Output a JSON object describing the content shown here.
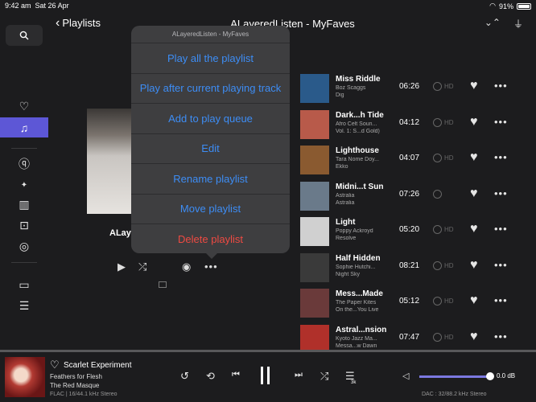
{
  "status_bar": {
    "time": "9:42 am",
    "date": "Sat 26 Apr",
    "battery": "91%"
  },
  "header": {
    "back_label": "Playlists",
    "title": "ALayeredListen - MyFaves"
  },
  "album": {
    "title_partial": "ALay"
  },
  "popover": {
    "heading": "ALayeredListen - MyFaves",
    "items": [
      "Play all the playlist",
      "Play after current playing track",
      "Add to play queue",
      "Edit",
      "Rename playlist",
      "Move playlist",
      "Delete playlist"
    ]
  },
  "tracks": [
    {
      "name": "Miss Riddle",
      "artist": "Boz Scaggs",
      "album": "Dig",
      "duration": "06:26",
      "quality": "HD",
      "art_color": "#2a5a8a"
    },
    {
      "name": "Dark...h Tide",
      "artist": "Afro Celt Soun...",
      "album": "Vol. 1: S...d Gold)",
      "duration": "04:12",
      "quality": "HD",
      "art_color": "#b85a4a"
    },
    {
      "name": "Lighthouse",
      "artist": "Tara Nome Doy...",
      "album": "Ekko",
      "duration": "04:07",
      "quality": "HD",
      "art_color": "#8a5a30"
    },
    {
      "name": "Midni...t Sun",
      "artist": "Astralia",
      "album": "Astralia",
      "duration": "07:26",
      "quality": "",
      "art_color": "#6a7a8a"
    },
    {
      "name": "Light",
      "artist": "Poppy Ackroyd",
      "album": "Resolve",
      "duration": "05:20",
      "quality": "HD",
      "art_color": "#d0d0d0"
    },
    {
      "name": "Half Hidden",
      "artist": "Sophie Hutchi...",
      "album": "Night Sky",
      "duration": "08:21",
      "quality": "HD",
      "art_color": "#3a3a3a"
    },
    {
      "name": "Mess...Made",
      "artist": "The Paper Kites",
      "album": "On the...You Live",
      "duration": "05:12",
      "quality": "HD",
      "art_color": "#6a3a3a"
    },
    {
      "name": "Astral...nsion",
      "artist": "Kyoto Jazz Ma...",
      "album": "Messa...w Dawn",
      "duration": "07:47",
      "quality": "HD",
      "art_color": "#b0302a"
    }
  ],
  "now_playing": {
    "title": "Scarlet Experiment",
    "album": "Feathers for Flesh",
    "artist": "The Red Masque",
    "format": "FLAC | 16/44.1 kHz Stereo",
    "queue_count": "3k",
    "volume": "0.0 dB",
    "dac": "DAC : 32/88.2 kHz Stereo"
  },
  "colors": {
    "accent": "#5d57d6",
    "link": "#3d8df5",
    "danger": "#ee4a42"
  }
}
